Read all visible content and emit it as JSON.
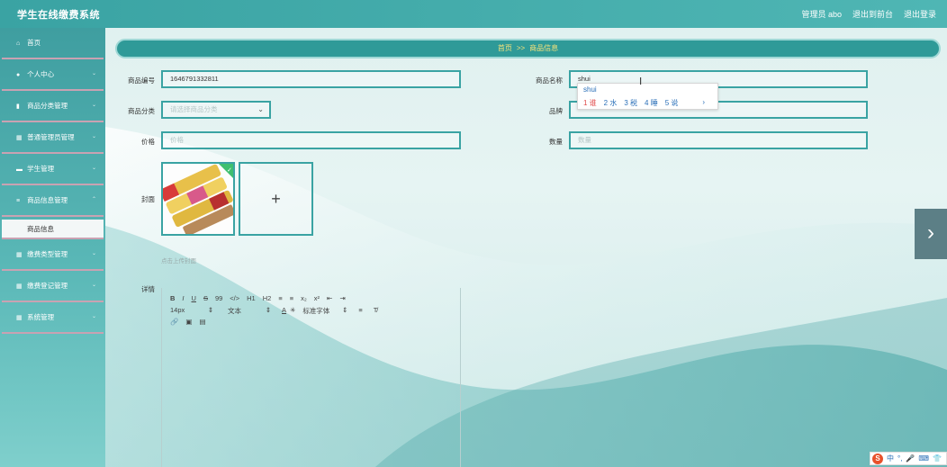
{
  "app": {
    "title": "学生在线缴费系统"
  },
  "header": {
    "user": "管理员 abo",
    "back_to_front": "退出到前台",
    "logout": "退出登录"
  },
  "sidebar": {
    "items": [
      {
        "label": "首页",
        "icon": "home-icon"
      },
      {
        "label": "个人中心",
        "icon": "user-icon"
      },
      {
        "label": "商品分类管理",
        "icon": "bar-chart-icon"
      },
      {
        "label": "普通管理员管理",
        "icon": "grid-icon"
      },
      {
        "label": "学生管理",
        "icon": "card-icon"
      },
      {
        "label": "商品信息管理",
        "icon": "list-icon"
      },
      {
        "label": "商品信息",
        "sub": true
      },
      {
        "label": "缴费类型管理",
        "icon": "grid-icon"
      },
      {
        "label": "缴费登记管理",
        "icon": "grid-icon"
      },
      {
        "label": "系统管理",
        "icon": "grid-icon"
      }
    ]
  },
  "breadcrumb": {
    "home": "首页",
    "sep": ">>",
    "current": "商品信息"
  },
  "form": {
    "code_label": "商品编号",
    "code_value": "1646791332811",
    "name_label": "商品名称",
    "name_value": "shui",
    "category_label": "商品分类",
    "category_placeholder": "请选择商品分类",
    "brand_label": "品牌",
    "price_label": "价格",
    "price_placeholder": "价格",
    "qty_label": "数量",
    "qty_placeholder": "数量",
    "cover_label": "封面",
    "upload_plus": "+",
    "upload_hint": "点击上传封面",
    "detail_label": "详情"
  },
  "ime": {
    "composition": "shui",
    "candidates": [
      "1 谁",
      "2 水",
      "3 税",
      "4 睡",
      "5 说"
    ],
    "more": "›"
  },
  "editor": {
    "row1": [
      "B",
      "I",
      "U",
      "S",
      "99",
      "</>",
      "H1",
      "H2",
      "≡",
      "≡",
      "x₂",
      "x²",
      "⇤",
      "⇥"
    ],
    "font_size": "14px",
    "text_type": "文本",
    "font_family": "标准字体",
    "row3": [
      "🔗",
      "▣",
      "▤"
    ]
  },
  "nav": {
    "next": "›"
  },
  "tray": {
    "items": [
      "中",
      "°,",
      "🎤",
      "⌨",
      "👕"
    ]
  },
  "colors": {
    "accent": "#3aa3a3",
    "breadcrumb_text": "#f6e27a"
  }
}
